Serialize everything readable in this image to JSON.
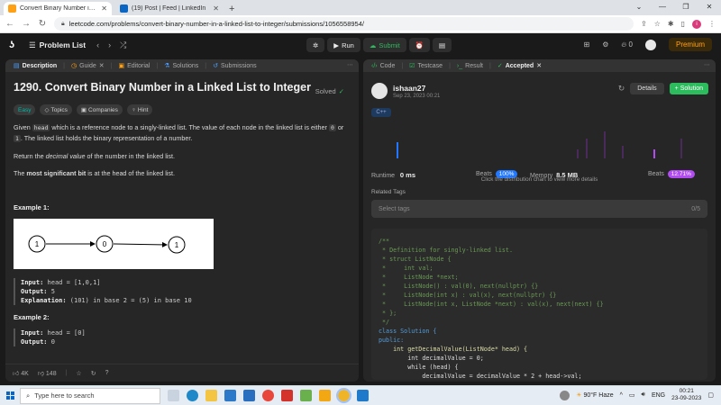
{
  "browser": {
    "tabs": [
      {
        "title": "Convert Binary Number in a Lin",
        "active": true,
        "favicon_color": "#ffa116"
      },
      {
        "title": "(19) Post | Feed | LinkedIn",
        "active": false,
        "favicon_color": "#0a66c2"
      }
    ],
    "new_tab": "+",
    "url": "leetcode.com/problems/convert-binary-number-in-a-linked-list-to-integer/submissions/1056558954/",
    "profile_initial": "i"
  },
  "lc_nav": {
    "problem_list": "Problem List",
    "run": "Run",
    "submit": "Submit",
    "streak": "0",
    "premium": "Premium"
  },
  "left_panel": {
    "tabs": [
      "Description",
      "Guide",
      "Editorial",
      "Solutions",
      "Submissions"
    ],
    "title": "1290. Convert Binary Number in a Linked List to Integer",
    "solved": "Solved",
    "tags": [
      "Easy",
      "Topics",
      "Companies",
      "Hint"
    ],
    "desc": {
      "p1_a": "Given ",
      "p1_code1": "head",
      "p1_b": " which is a reference node to a singly-linked list. The value of each node in the linked list is either ",
      "p1_code2": "0",
      "p1_c": " or ",
      "p1_code3": "1",
      "p1_d": ". The linked list holds the binary representation of a number.",
      "p2_a": "Return the ",
      "p2_em": "decimal value",
      "p2_b": " of the number in the linked list.",
      "p3_a": "The ",
      "p3_bold": "most significant bit",
      "p3_b": " is at the head of the linked list."
    },
    "example1": {
      "heading": "Example 1:",
      "nodes": [
        "1",
        "0",
        "1"
      ],
      "input_label": "Input:",
      "input": " head = [1,0,1]",
      "output_label": "Output:",
      "output": " 5",
      "expl_label": "Explanation:",
      "expl": " (101) in base 2 = (5) in base 10"
    },
    "example2": {
      "heading": "Example 2:",
      "input_label": "Input:",
      "input": " head = [0]",
      "output_label": "Output:",
      "output": " 0"
    },
    "footer": {
      "likes": "4K",
      "dislikes": "148"
    }
  },
  "right_panel": {
    "tabs": [
      "Code",
      "Testcase",
      "Result",
      "Accepted"
    ],
    "user": "ishaan27",
    "date": "Sep 23, 2023 00:21",
    "details": "Details",
    "solution": "+ Solution",
    "language": "C++",
    "runtime_label": "Runtime",
    "runtime": "0 ms",
    "beats_label": "Beats",
    "runtime_beats": "100%",
    "memory_label": "Memory",
    "memory": "8.5 MB",
    "memory_beats": "12.71%",
    "chart_note": "Click the distribution chart to view more details",
    "related_tags": "Related Tags",
    "select_tags": "Select tags",
    "tag_count": "0/5",
    "code_lines": [
      "/**",
      " * Definition for singly-linked list.",
      " * struct ListNode {",
      " *     int val;",
      " *     ListNode *next;",
      " *     ListNode() : val(0), next(nullptr) {}",
      " *     ListNode(int x) : val(x), next(nullptr) {}",
      " *     ListNode(int x, ListNode *next) : val(x), next(next) {}",
      " * };",
      " */",
      "class Solution {",
      "public:",
      "    int getDecimalValue(ListNode* head) {",
      "        int decimalValue = 0;",
      "        while (head) {",
      "            decimalValue = decimalValue * 2 + head->val;"
    ]
  },
  "taskbar": {
    "search_placeholder": "Type here to search",
    "weather": "90°F Haze",
    "lang": "ENG",
    "time": "00:21",
    "date": "23-09-2023"
  },
  "colors": {
    "accent_green": "#2cbb5d",
    "accent_orange": "#ffa116",
    "runtime_badge": "#2277ff",
    "memory_badge": "#b04cf0"
  }
}
